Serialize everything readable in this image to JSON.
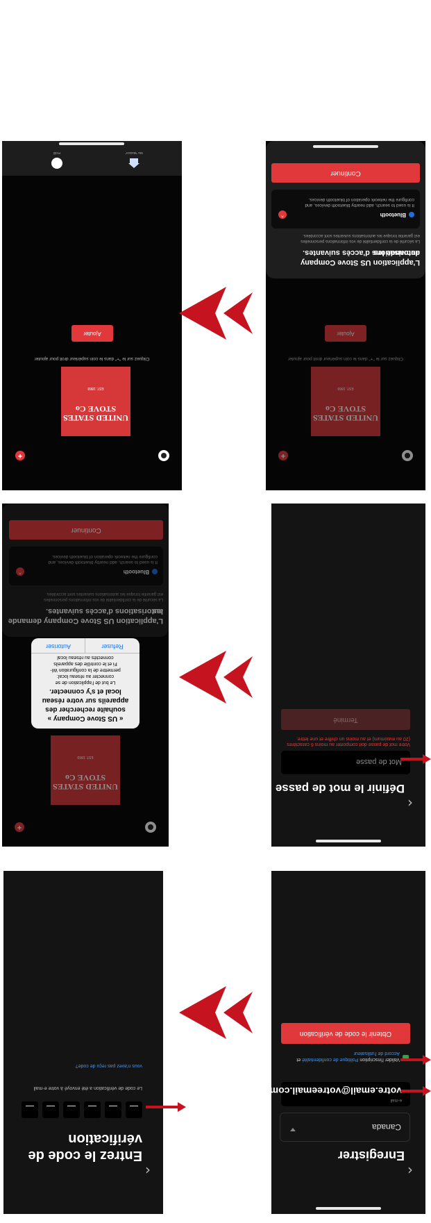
{
  "colors": {
    "accent": "#e0383b",
    "arrow": "#c5131f",
    "link": "#4a90e2"
  },
  "step1": {
    "title": "Enregistrer",
    "country": "Canada",
    "email_label": "e-mail",
    "email_value": "votre.email@votreemail.com",
    "consent_prefix": "Valider l'inscription",
    "privacy_link": "Politique de confidentialité",
    "consent_and": "et",
    "user_agreement_link": "Accord de l'utilisateur",
    "get_code_button": "Obtenir le code de vérification"
  },
  "step2": {
    "title_line1": "Entrez le code de",
    "title_line2": "vérification",
    "sent_text": "Le code de vérification a été envoyé à votre e-mail",
    "resend_link": "vous n'avez pas reçu de code?"
  },
  "step3": {
    "title": "Définir le mot de passe",
    "password_placeholder": "Mot de passe",
    "hint_line1": "Votre mot de passe doit comporter au moins 6 caractères",
    "hint_line2": "(20 au maximum) et au moins un chiffre et une lettre.",
    "done_button": "Terminé"
  },
  "home": {
    "brand_line1": "UNITED STATES",
    "brand_line2": "STOVE Co",
    "brand_est": "EST. 1869",
    "add_hint": "Cliquez sur le \"+\" dans le coin supérieur droit pour ajouter",
    "add_button": "Ajouter",
    "tab_home": "Ma \"Maison\"",
    "tab_profile": "Profil"
  },
  "permissions": {
    "title_line1": "L'application US Stove Company demande les",
    "title_line2": "autorisations d'accès suivantes.",
    "subtitle_line1": "La sécurité de la confidentialité de vos informations personnelles",
    "subtitle_line2": "est garantie lorsque les autorisations suivantes sont accordées.",
    "bt_name": "Bluetooth",
    "bt_desc_line1": "It is used to search, add nearby bluetooth devices, and",
    "bt_desc_line2": "configure the network operation of bluetooth devices.",
    "continue_button": "Continuer"
  },
  "network_alert": {
    "title_line1": "« US Stove Company »",
    "title_line2": "souhaite rechercher des",
    "title_line3": "appareils sur votre réseau",
    "title_line4": "local et s'y connecter.",
    "msg_line1": "Le but de l'application de se",
    "msg_line2": "connecter au réseau local:",
    "msg_line3": "permettre de la configuration Wi-",
    "msg_line4": "Fi et le contrôle des appareils",
    "msg_line5": "connectés au réseau local",
    "deny_button": "Refuser",
    "allow_button": "Autoriser"
  }
}
